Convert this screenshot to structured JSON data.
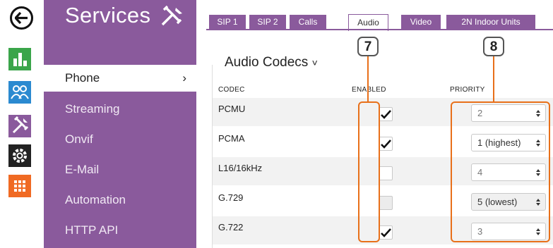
{
  "rail": {
    "icons": [
      "back-arrow-icon",
      "status-chart-icon",
      "users-icon",
      "services-tools-icon",
      "settings-gear-icon",
      "grid-apps-icon"
    ],
    "colors": {
      "chart": "#3aa54a",
      "users": "#2b8ad0",
      "tools": "#8a5a9c",
      "gear": "#222222",
      "grid": "#f06a23"
    }
  },
  "sidebar": {
    "title": "Services",
    "items": [
      {
        "label": "Phone",
        "active": true
      },
      {
        "label": "Streaming"
      },
      {
        "label": "Onvif"
      },
      {
        "label": "E-Mail"
      },
      {
        "label": "Automation"
      },
      {
        "label": "HTTP API"
      }
    ],
    "chevron": "›"
  },
  "tabs": [
    {
      "label": "SIP 1"
    },
    {
      "label": "SIP 2"
    },
    {
      "label": "Calls"
    },
    {
      "label": "Audio",
      "active": true
    },
    {
      "label": "Video"
    },
    {
      "label": "2N Indoor Units"
    }
  ],
  "section": {
    "title": "Audio Codecs",
    "chevron": "˅"
  },
  "table": {
    "headers": {
      "codec": "CODEC",
      "enabled": "ENABLED",
      "priority": "PRIORITY"
    },
    "rows": [
      {
        "codec": "PCMU",
        "enabled": true,
        "priority": "2"
      },
      {
        "codec": "PCMA",
        "enabled": true,
        "priority": "1 (highest)"
      },
      {
        "codec": "L16/16kHz",
        "enabled": false,
        "priority": "4"
      },
      {
        "codec": "G.729",
        "enabled": false,
        "disabled": true,
        "priority": "5 (lowest)"
      },
      {
        "codec": "G.722",
        "enabled": true,
        "priority": "3"
      }
    ]
  },
  "callouts": {
    "enabled": "7",
    "priority": "8"
  },
  "accent": "#8a5a9c",
  "callout_color": "#e8701a"
}
